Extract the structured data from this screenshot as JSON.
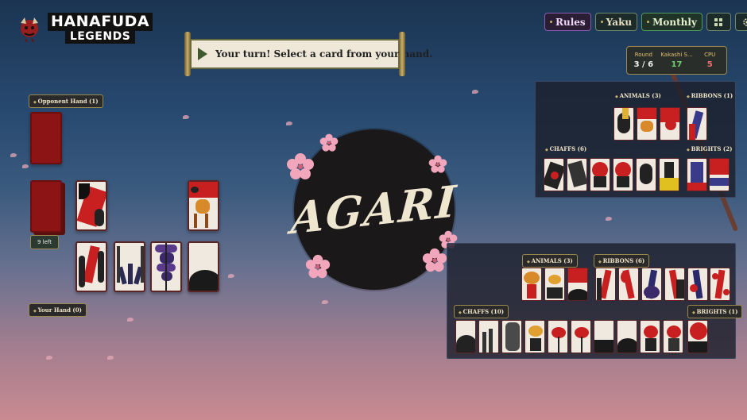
{
  "app": {
    "title": "HANAFUDA",
    "subtitle": "LEGENDS"
  },
  "turn_message": "Your turn! Select a card from your hand.",
  "toolbar": {
    "rules": "Rules",
    "yaku": "Yaku",
    "monthly": "Monthly",
    "grid_icon": "grid-icon",
    "settings_icon": "gear-icon"
  },
  "scoreboard": {
    "round_label": "Round",
    "round_value": "3 / 6",
    "player_label": "Kakashi S...",
    "player_value": "17",
    "cpu_label": "CPU",
    "cpu_value": "5"
  },
  "opponent_hand_label": "Opponent Hand (1)",
  "deck_label": "9 left",
  "your_hand_label": "Your Hand (0)",
  "result_text": "AGARI",
  "opponent_captures": {
    "animals": "ANIMALS (3)",
    "ribbons": "RIBBONS (1)",
    "chaffs": "CHAFFS (6)",
    "brights": "BRIGHTS (2)"
  },
  "player_captures": {
    "animals": "ANIMALS (3)",
    "ribbons": "RIBBONS (6)",
    "chaffs": "CHAFFS (10)",
    "brights": "BRIGHTS (1)"
  },
  "colors": {
    "card_back": "#8c1414",
    "accent_gold": "#c9b06a",
    "cpu_score": "#ef6f6f",
    "player_score": "#6fcf6f"
  }
}
